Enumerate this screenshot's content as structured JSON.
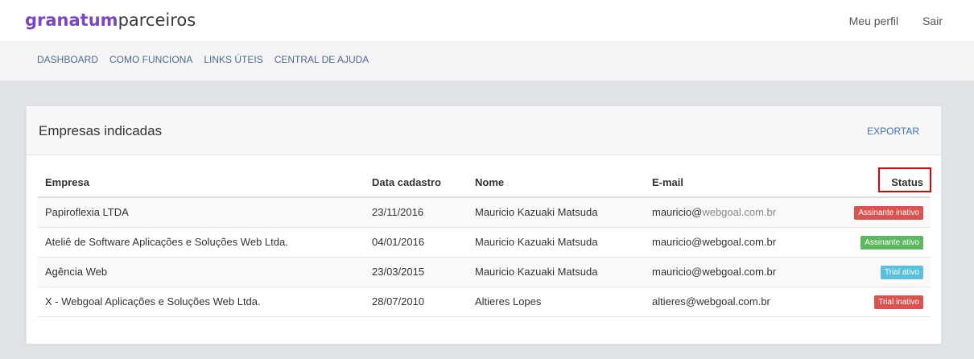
{
  "header": {
    "logo_brand": "granatum",
    "logo_sub": "parceiros",
    "nav": [
      "Meu perfil",
      "Sair"
    ]
  },
  "subnav": {
    "items": [
      "DASHBOARD",
      "COMO FUNCIONA",
      "LINKS ÚTEIS",
      "CENTRAL DE AJUDA"
    ]
  },
  "panel": {
    "title": "Empresas indicadas",
    "export_label": "EXPORTAR",
    "columns": [
      "Empresa",
      "Data cadastro",
      "Nome",
      "E-mail",
      "Status"
    ],
    "rows": [
      {
        "empresa": "Papiroflexia LTDA",
        "data": "23/11/2016",
        "nome": "Mauricio Kazuaki Matsuda",
        "email_user": "mauricio@",
        "email_domain": "webgoal.com.br",
        "status": "Assinante inativo"
      },
      {
        "empresa": "Ateliê de Software Aplicações e Soluções Web Ltda.",
        "data": "04/01/2016",
        "nome": "Mauricio Kazuaki Matsuda",
        "email_user": "mauricio@webgoal.com.br",
        "email_domain": "",
        "status": "Assinante ativo"
      },
      {
        "empresa": "Agência Web",
        "data": "23/03/2015",
        "nome": "Mauricio Kazuaki Matsuda",
        "email_user": "mauricio@webgoal.com.br",
        "email_domain": "",
        "status": "Trial ativo"
      },
      {
        "empresa": "X - Webgoal Aplicações e Soluções Web Ltda.",
        "data": "28/07/2010",
        "nome": "Altieres Lopes",
        "email_user": "altieres@webgoal.com.br",
        "email_domain": "",
        "status": "Trial inativo"
      }
    ]
  },
  "colors": {
    "brand": "#7b45c4",
    "badge_inactive": "#d9534f",
    "badge_active": "#5cb85c",
    "badge_trial_active": "#5bc0de",
    "highlight": "#e60000"
  }
}
